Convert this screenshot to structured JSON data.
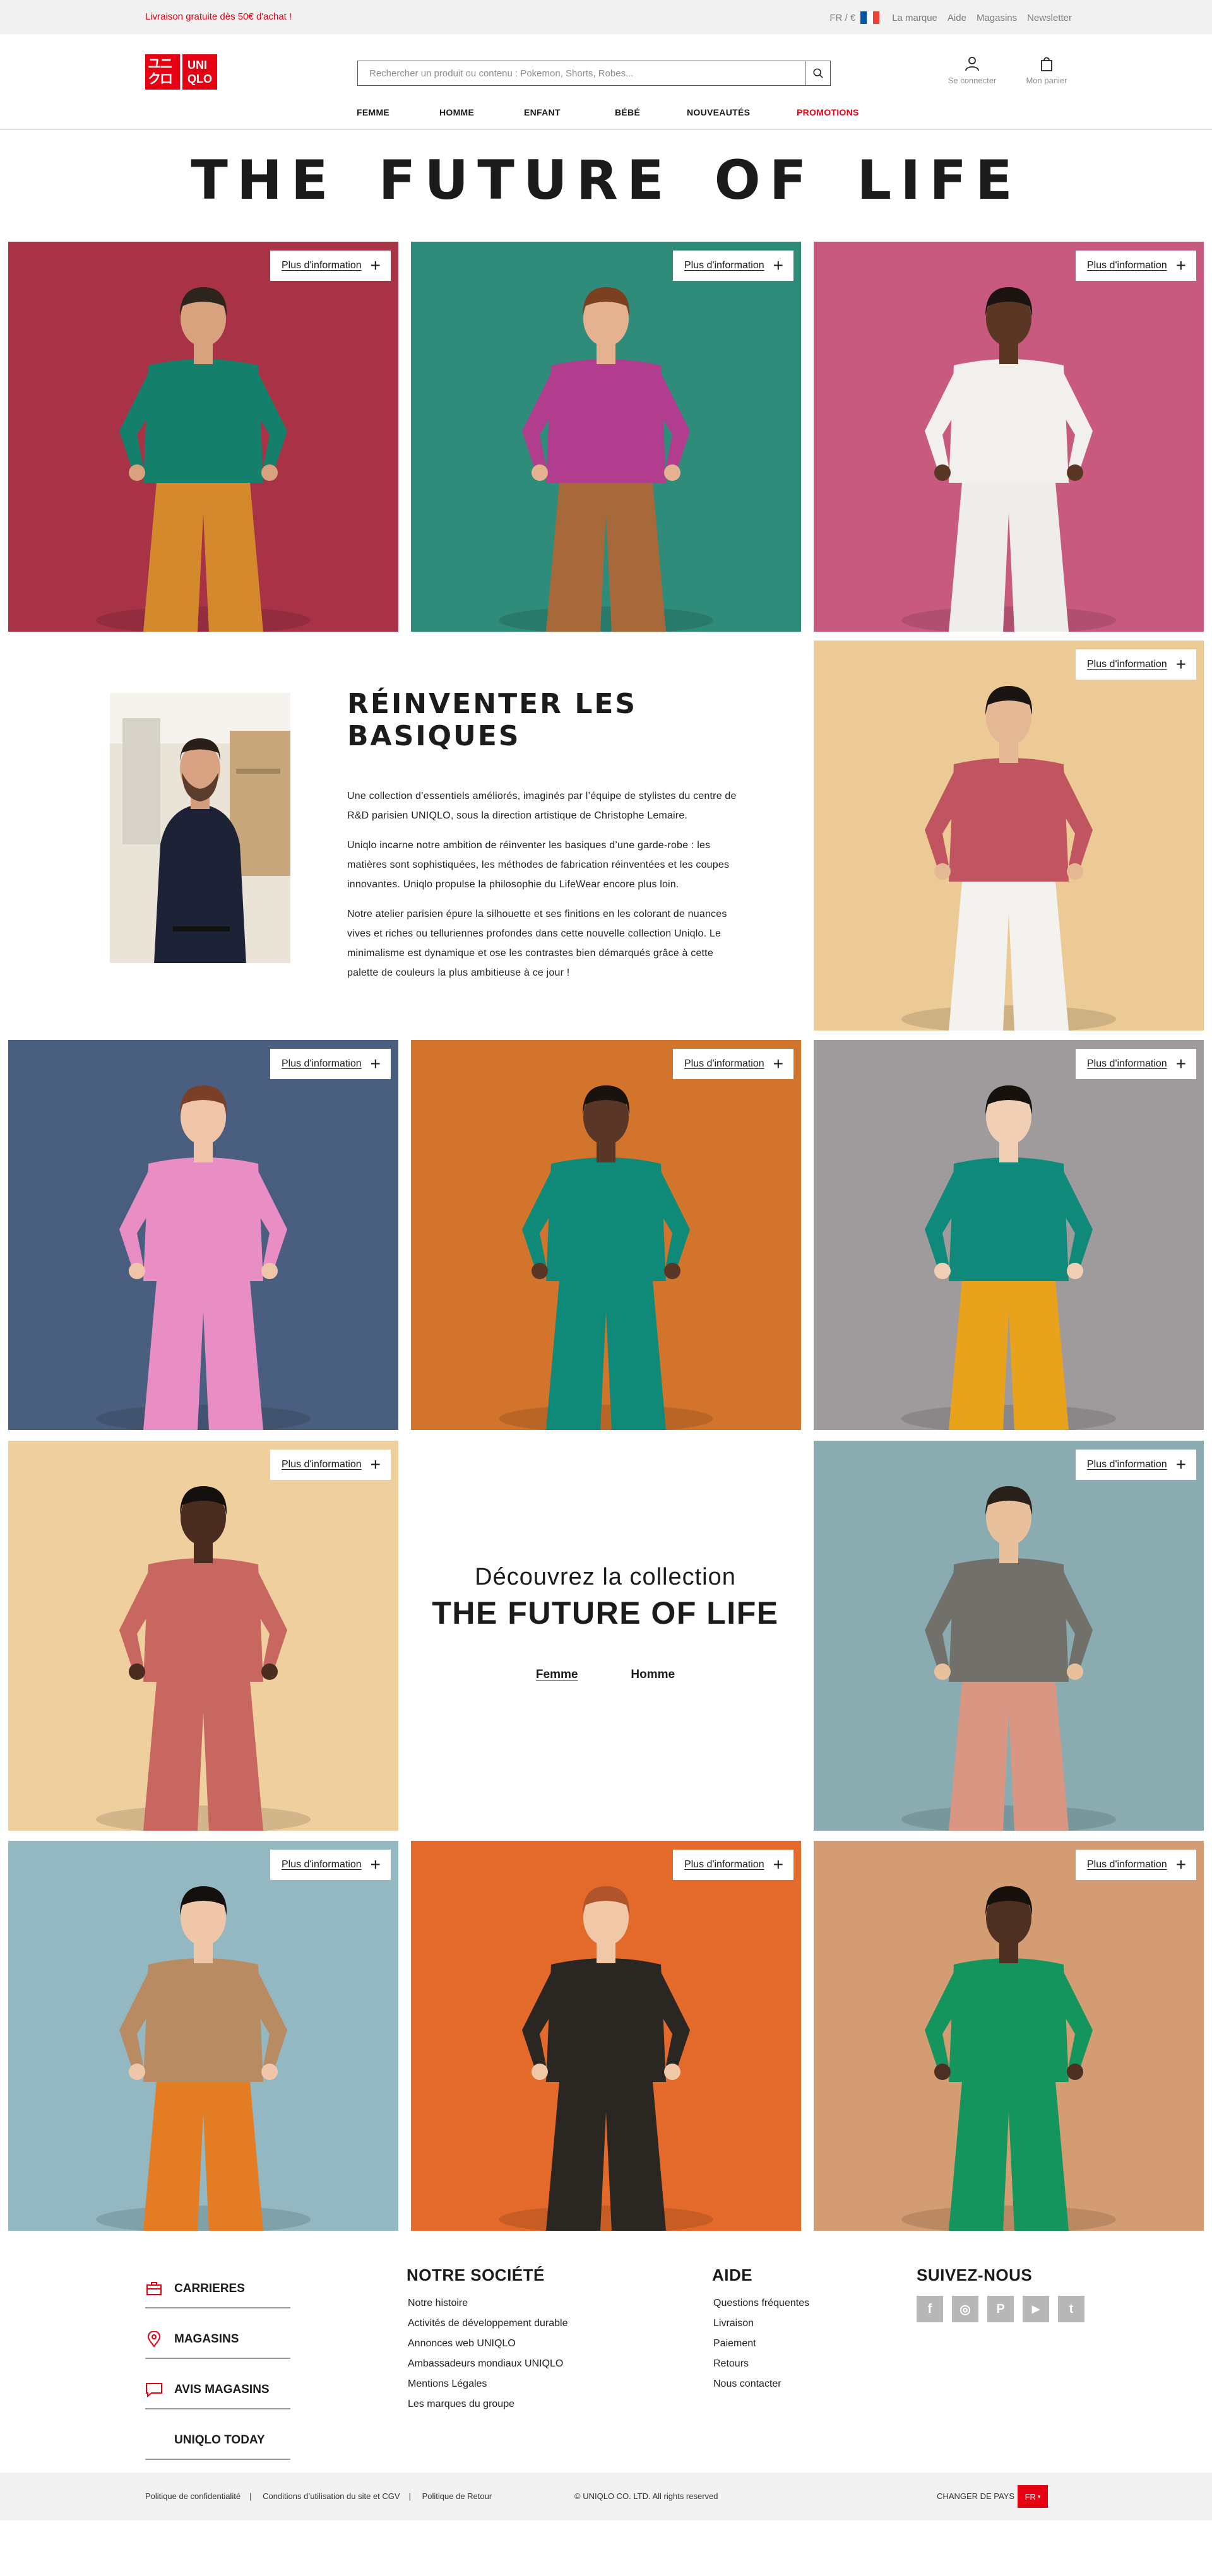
{
  "topbar": {
    "promo": "Livraison gratuite dès 50€ d'achat !",
    "locale": "FR / €",
    "flag_colors": [
      "#0055a4",
      "#ffffff",
      "#ef4135"
    ],
    "links": [
      "La marque",
      "Aide",
      "Magasins",
      "Newsletter"
    ]
  },
  "header": {
    "logo_top": "ユニクロ",
    "logo_bottom": "UNIQLO",
    "search_placeholder": "Rechercher un produit ou contenu : Pokemon, Shorts, Robes...",
    "account_label": "Se connecter",
    "cart_label": "Mon panier",
    "nav": [
      "FEMME",
      "HOMME",
      "ENFANT",
      "BÉBÉ",
      "NOUVEAUTÉS",
      "PROMOTIONS"
    ]
  },
  "hero_title": "THE FUTURE OF LIFE",
  "more_label": "Plus d'information",
  "tiles": [
    {
      "bg": "#a83347",
      "top": "#14806b",
      "bottom": "#d4892d",
      "skin": "#d9a27f",
      "hair": "#2e241e"
    },
    {
      "bg": "#2f8b7a",
      "top": "#b23d8f",
      "bottom": "#a8693a",
      "skin": "#e4b290",
      "hair": "#7c3f1f"
    },
    {
      "bg": "#c95a7f",
      "top": "#f2f0ec",
      "bottom": "#efedea",
      "skin": "#5a3624",
      "hair": "#1c1410"
    },
    {
      "bg": "#ebca95",
      "top": "#c05460",
      "bottom": "#f4f2ef",
      "skin": "#e5b895",
      "hair": "#1a1512"
    },
    {
      "bg": "#4a5f7f",
      "top": "#e98dc5",
      "bottom": "#e98dc5",
      "skin": "#efc4a8",
      "hair": "#7a4027"
    },
    {
      "bg": "#d3742c",
      "top": "#0f8a78",
      "bottom": "#0f8a78",
      "skin": "#5a3626",
      "hair": "#1a120e"
    },
    {
      "bg": "#9f9a9c",
      "top": "#0f8a7a",
      "bottom": "#e8a21c",
      "skin": "#f0cfb5",
      "hair": "#17110e"
    },
    {
      "bg": "#efcf9d",
      "top": "#c86660",
      "bottom": "#c86660",
      "skin": "#4a2d20",
      "hair": "#14100d"
    },
    {
      "bg": "#8aabb0",
      "top": "#72706a",
      "bottom": "#d89683",
      "skin": "#e8c19c",
      "hair": "#2a201a"
    },
    {
      "bg": "#93b8c1",
      "top": "#b98b63",
      "bottom": "#e37c23",
      "skin": "#efc6a8",
      "hair": "#14100e"
    },
    {
      "bg": "#e36a2a",
      "top": "#2a2622",
      "bottom": "#2a2622",
      "skin": "#f0c8a8",
      "hair": "#b0542c"
    },
    {
      "bg": "#d49c72",
      "top": "#14955e",
      "bottom": "#14955e",
      "skin": "#4e3022",
      "hair": "#17110e"
    }
  ],
  "article": {
    "title": "RÉINVENTER LES BASIQUES",
    "p1": "Une collection d’essentiels améliorés, imaginés par l’équipe de stylistes du centre de R&D parisien UNIQLO, sous la direction artistique de Christophe Lemaire.",
    "p2": "Uniqlo incarne notre ambition de réinventer les basiques d’une garde-robe : les matières sont sophistiquées, les méthodes de fabrication réinventées et les coupes innovantes. Uniqlo propulse la philosophie du LifeWear encore plus loin.",
    "p3": "Notre atelier parisien épure la silhouette et ses finitions en les colorant de nuances vives et riches ou telluriennes profondes dans cette nouvelle collection Uniqlo. Le minimalisme est dynamique et ose les contrastes bien démarqués grâce à cette palette de couleurs la plus ambitieuse à ce jour !"
  },
  "discover": {
    "line1": "Découvrez la collection",
    "line2": "THE FUTURE OF LIFE",
    "link_women": "Femme",
    "link_men": "Homme"
  },
  "footer": {
    "col1": [
      "CARRIERES",
      "MAGASINS",
      "AVIS MAGASINS",
      "UNIQLO TODAY"
    ],
    "col1_icons": [
      "briefcase-icon",
      "location-pin-icon",
      "chat-bubble-icon",
      ""
    ],
    "company_title": "NOTRE SOCIÉTÉ",
    "company_links": [
      "Notre histoire",
      "Activités de développement durable",
      "Annonces web UNIQLO",
      "Ambassadeurs mondiaux UNIQLO",
      "Mentions Légales",
      "Les marques du groupe"
    ],
    "help_title": "AIDE",
    "help_links": [
      "Questions fréquentes",
      "Livraison",
      "Paiement",
      "Retours",
      "Nous contacter"
    ],
    "follow_title": "SUIVEZ-NOUS",
    "social": [
      "f",
      "◎",
      "P",
      "▶",
      "t"
    ],
    "social_icons": [
      "facebook-icon",
      "instagram-icon",
      "pinterest-icon",
      "youtube-icon",
      "twitter-icon"
    ],
    "legal": [
      "Politique de confidentialité",
      "Conditions d’utilisation du site et CGV",
      "Politique de Retour"
    ],
    "copyright": "© UNIQLO CO. LTD. All rights reserved",
    "change_country": "CHANGER DE PAYS",
    "country_code": "FR"
  }
}
